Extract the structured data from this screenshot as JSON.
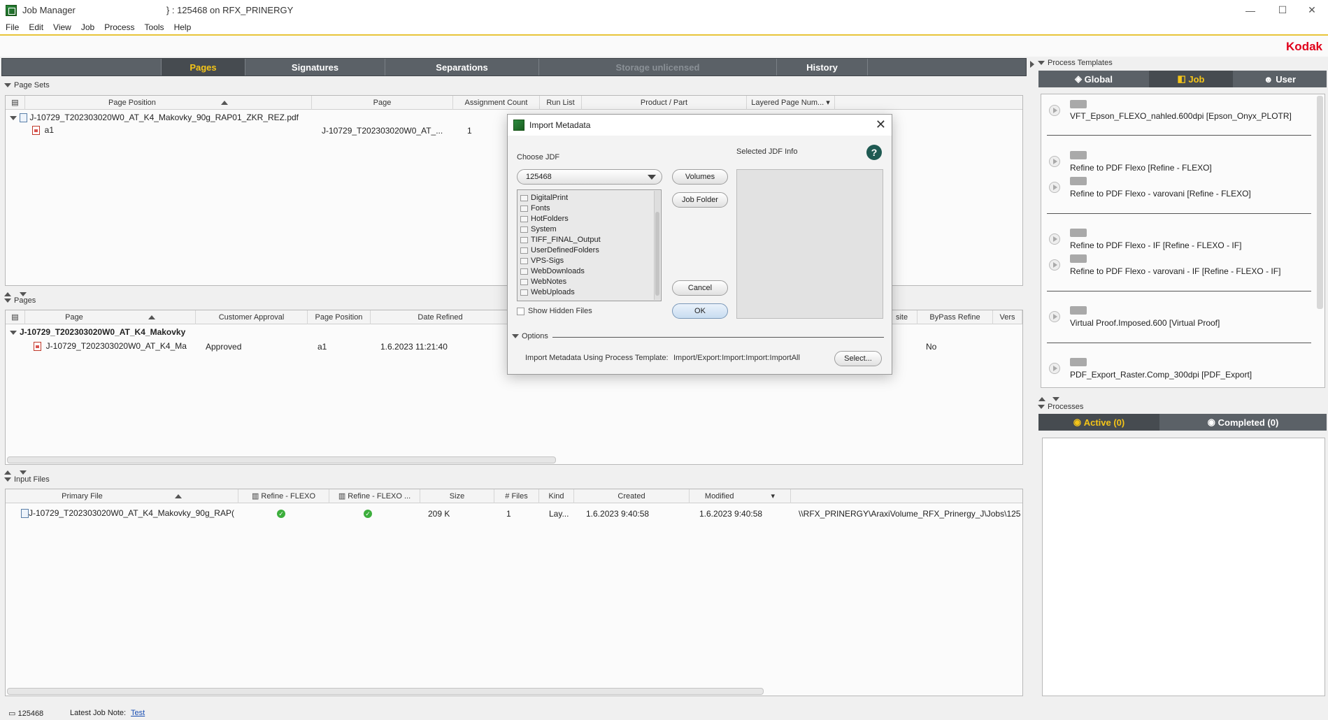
{
  "window": {
    "title_app": "Job Manager",
    "title_job": "} : 125468 on RFX_PRINERGY",
    "min": "—",
    "max": "☐",
    "close": "✕"
  },
  "menu": [
    "File",
    "Edit",
    "View",
    "Job",
    "Process",
    "Tools",
    "Help"
  ],
  "brand": "Kodak",
  "main_tabs": [
    {
      "label": "Pages",
      "state": "active"
    },
    {
      "label": "Signatures",
      "state": "normal"
    },
    {
      "label": "Separations",
      "state": "normal"
    },
    {
      "label": "Storage unlicensed",
      "state": "disabled"
    },
    {
      "label": "History",
      "state": "normal"
    }
  ],
  "page_sets": {
    "header": "Page Sets",
    "columns": [
      "Page Position",
      "Page",
      "Assignment Count",
      "Run List",
      "Product / Part",
      "Layered Page Num..."
    ],
    "file": "J-10729_T202303020W0_AT_K4_Makovky_90g_RAP01_ZKR_REZ.pdf",
    "row": {
      "position": "a1",
      "page": "J-10729_T202303020W0_AT_...",
      "count": "1"
    }
  },
  "pages": {
    "header": "Pages",
    "columns": [
      "Page",
      "Customer Approval",
      "Page Position",
      "Date Refined",
      "site",
      "ByPass Refine",
      "Vers"
    ],
    "group": "J-10729_T202303020W0_AT_K4_Makovky",
    "row": {
      "page": "J-10729_T202303020W0_AT_K4_Ma",
      "approval": "Approved",
      "position": "a1",
      "date": "1.6.2023 11:21:40",
      "bypass": "No"
    }
  },
  "input_files": {
    "header": "Input Files",
    "columns": [
      "Primary File",
      "Refine - FLEXO",
      "Refine - FLEXO ...",
      "Size",
      "# Files",
      "Kind",
      "Created",
      "Modified"
    ],
    "row": {
      "file": "J-10729_T202303020W0_AT_K4_Makovky_90g_RAP(",
      "size": "209 K",
      "files": "1",
      "kind": "Lay...",
      "created": "1.6.2023 9:40:58",
      "modified": "1.6.2023 9:40:58",
      "path": "\\\\RFX_PRINERGY\\AraxiVolume_RFX_Prinergy_J\\Jobs\\125"
    }
  },
  "process_templates": {
    "header": "Process Templates",
    "tabs": [
      "Global",
      "Job",
      "User"
    ],
    "items": [
      "VFT_Epson_FLEXO_nahled.600dpi [Epson_Onyx_PLOTR]",
      "Refine to PDF Flexo [Refine - FLEXO]",
      "Refine to PDF Flexo - varovani [Refine - FLEXO]",
      "Refine to PDF Flexo - IF [Refine - FLEXO - IF]",
      "Refine to PDF Flexo - varovani - IF [Refine - FLEXO - IF]",
      "Virtual Proof.Imposed.600 [Virtual Proof]",
      "PDF_Export_Raster.Comp_300dpi [PDF_Export]"
    ]
  },
  "processes": {
    "header": "Processes",
    "tabs": [
      "Active (0)",
      "Completed (0)"
    ]
  },
  "status": {
    "job": "125468",
    "note_label": "Latest Job Note:",
    "note_link": "Test"
  },
  "dialog": {
    "title": "Import Metadata",
    "choose_label": "Choose JDF",
    "selected_label": "Selected JDF Info",
    "jdf_value": "125468",
    "folders": [
      "DigitalPrint",
      "Fonts",
      "HotFolders",
      "System",
      "TIFF_FINAL_Output",
      "UserDefinedFolders",
      "VPS-Sigs",
      "WebDownloads",
      "WebNotes",
      "WebUploads"
    ],
    "show_hidden": "Show Hidden Files",
    "volumes": "Volumes",
    "job_folder": "Job Folder",
    "cancel": "Cancel",
    "ok": "OK",
    "options_label": "Options",
    "import_label": "Import Metadata Using Process Template:",
    "import_value": "Import/Export:Import:Import:ImportAll",
    "select": "Select...",
    "help": "?"
  }
}
